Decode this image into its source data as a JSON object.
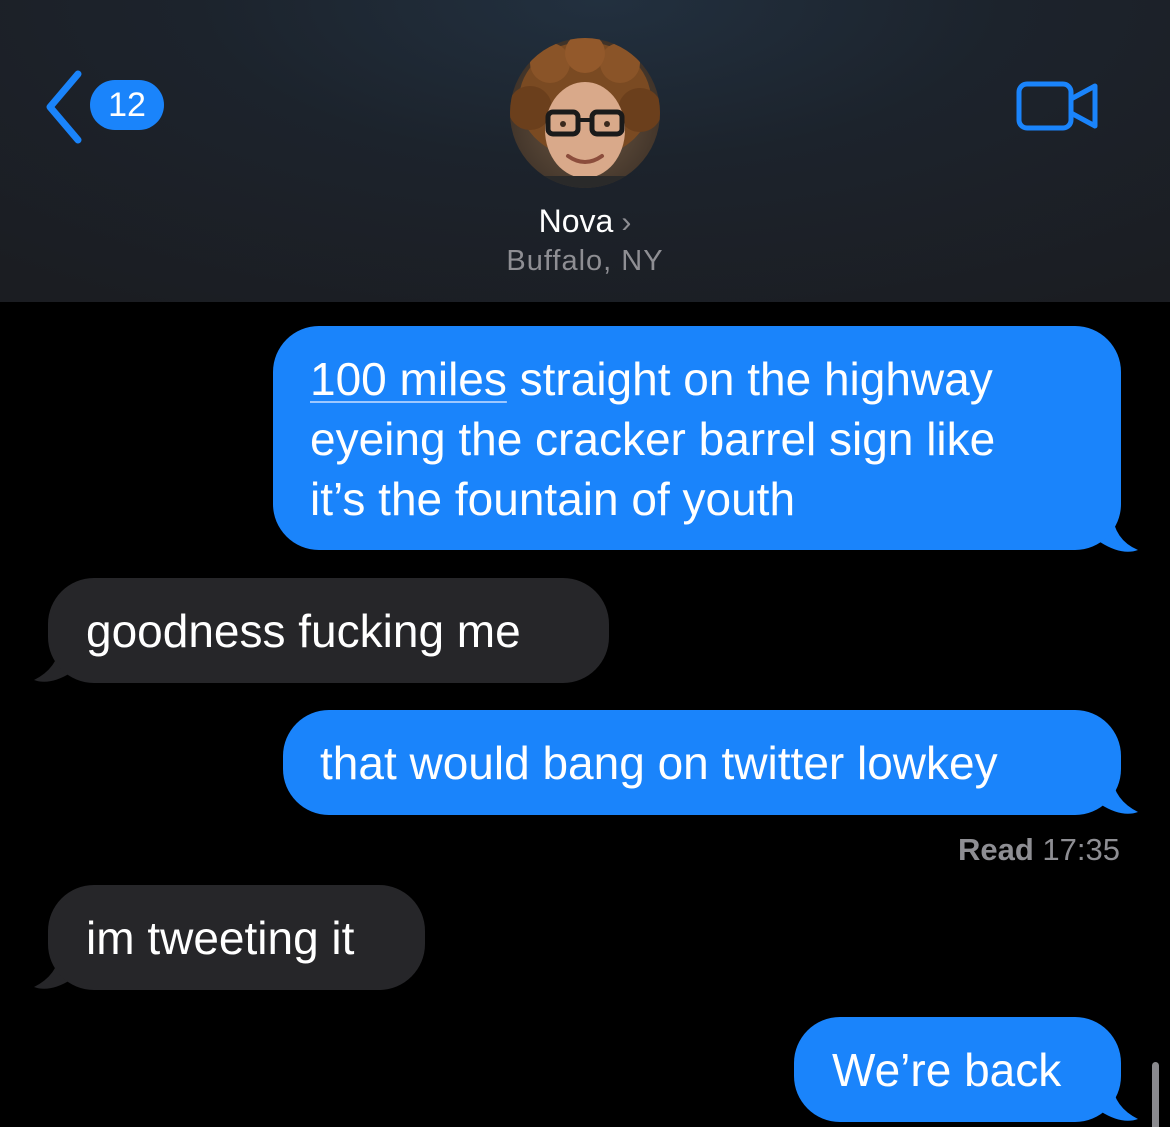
{
  "header": {
    "back_count": "12",
    "contact_name": "Nova",
    "contact_location": "Buffalo, NY"
  },
  "messages": [
    {
      "direction": "sent",
      "link_text": "100 miles",
      "line1_rest": " straight on the highway",
      "line2": "eyeing the cracker barrel sign like",
      "line3": "it’s the fountain of youth"
    },
    {
      "direction": "received",
      "text": "goodness fucking me"
    },
    {
      "direction": "sent",
      "text": "that would bang on twitter lowkey"
    },
    {
      "direction": "received",
      "text": "im tweeting it"
    },
    {
      "direction": "sent",
      "text": "We’re back"
    }
  ],
  "read_receipt": {
    "label": "Read",
    "time": "17:35"
  },
  "colors": {
    "sent_bubble": "#1a84fb",
    "received_bubble": "#262629",
    "accent": "#1a84fb",
    "secondary_text": "#8e8e93"
  }
}
